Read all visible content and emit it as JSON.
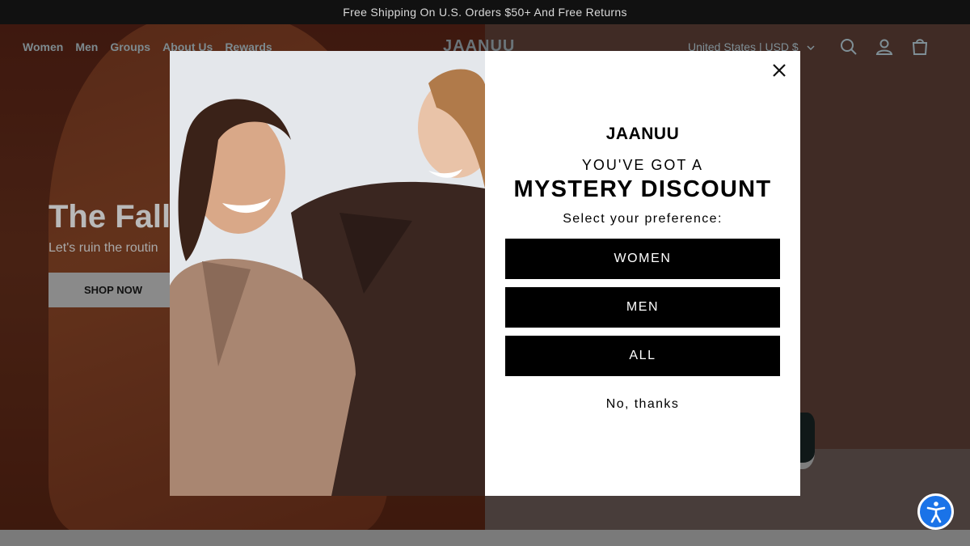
{
  "announcement": {
    "text": "Free Shipping On U.S. Orders $50+ And Free Returns"
  },
  "header": {
    "nav": [
      "Women",
      "Men",
      "Groups",
      "About Us",
      "Rewards"
    ],
    "logo": "JAANUU",
    "country_selector": "United States | USD $",
    "icons": [
      "search-icon",
      "account-icon",
      "cart-icon"
    ]
  },
  "hero": {
    "title": "The Fall",
    "subtitle": "Let's ruin the routin",
    "cta": "SHOP NOW"
  },
  "popup": {
    "logo": "JAANUU",
    "heading_line1": "YOU'VE GOT A",
    "heading_line2": "MYSTERY DISCOUNT",
    "prompt": "Select your preference:",
    "options": [
      "WOMEN",
      "MEN",
      "ALL"
    ],
    "decline": "No, thanks",
    "close_icon": "close-icon"
  },
  "accessibility": {
    "icon": "accessibility-icon",
    "color": "#1a73e8"
  },
  "colors": {
    "button_bg": "#000000",
    "button_text": "#ffffff",
    "announcement_bg": "#111111"
  }
}
